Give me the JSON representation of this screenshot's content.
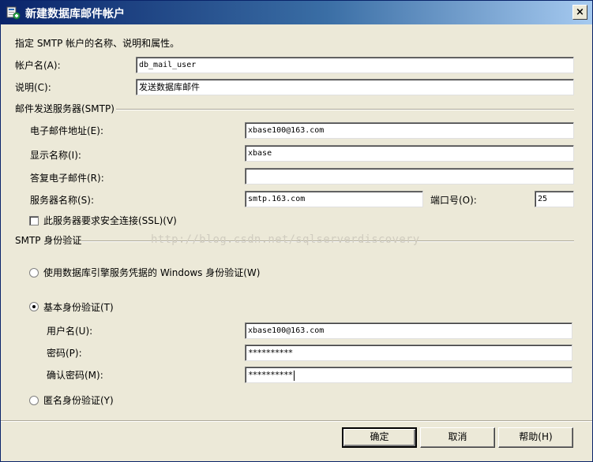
{
  "window": {
    "title": "新建数据库邮件帐户",
    "close_label": "×"
  },
  "intro": "指定 SMTP 帐户的名称、说明和属性。",
  "account": {
    "name_label": "帐户名(A):",
    "name_value": "db_mail_user",
    "desc_label": "说明(C):",
    "desc_value": "发送数据库邮件"
  },
  "smtp_server": {
    "group_label": "邮件发送服务器(SMTP)",
    "email_label": "电子邮件地址(E):",
    "email_value": "xbase100@163.com",
    "display_label": "显示名称(I):",
    "display_value": "xbase",
    "reply_label": "答复电子邮件(R):",
    "reply_value": "",
    "server_label": "服务器名称(S):",
    "server_value": "smtp.163.com",
    "port_label": "端口号(O):",
    "port_value": "25",
    "ssl_label": "此服务器要求安全连接(SSL)(V)",
    "ssl_checked": false
  },
  "auth": {
    "group_label": "SMTP 身份验证",
    "windows_label": "使用数据库引擎服务凭据的 Windows 身份验证(W)",
    "basic_label": "基本身份验证(T)",
    "selected": "basic",
    "user_label": "用户名(U):",
    "user_value": "xbase100@163.com",
    "password_label": "密码(P):",
    "password_value": "**********",
    "confirm_label": "确认密码(M):",
    "confirm_value": "**********",
    "anonymous_label": "匿名身份验证(Y)"
  },
  "watermark": "http://blog.csdn.net/sqlserverdiscovery",
  "buttons": {
    "ok": "确定",
    "cancel": "取消",
    "help": "帮助(H)"
  },
  "colors": {
    "title_start": "#0a246a",
    "title_end": "#a6caf0",
    "dialog_bg": "#ece9d8"
  }
}
